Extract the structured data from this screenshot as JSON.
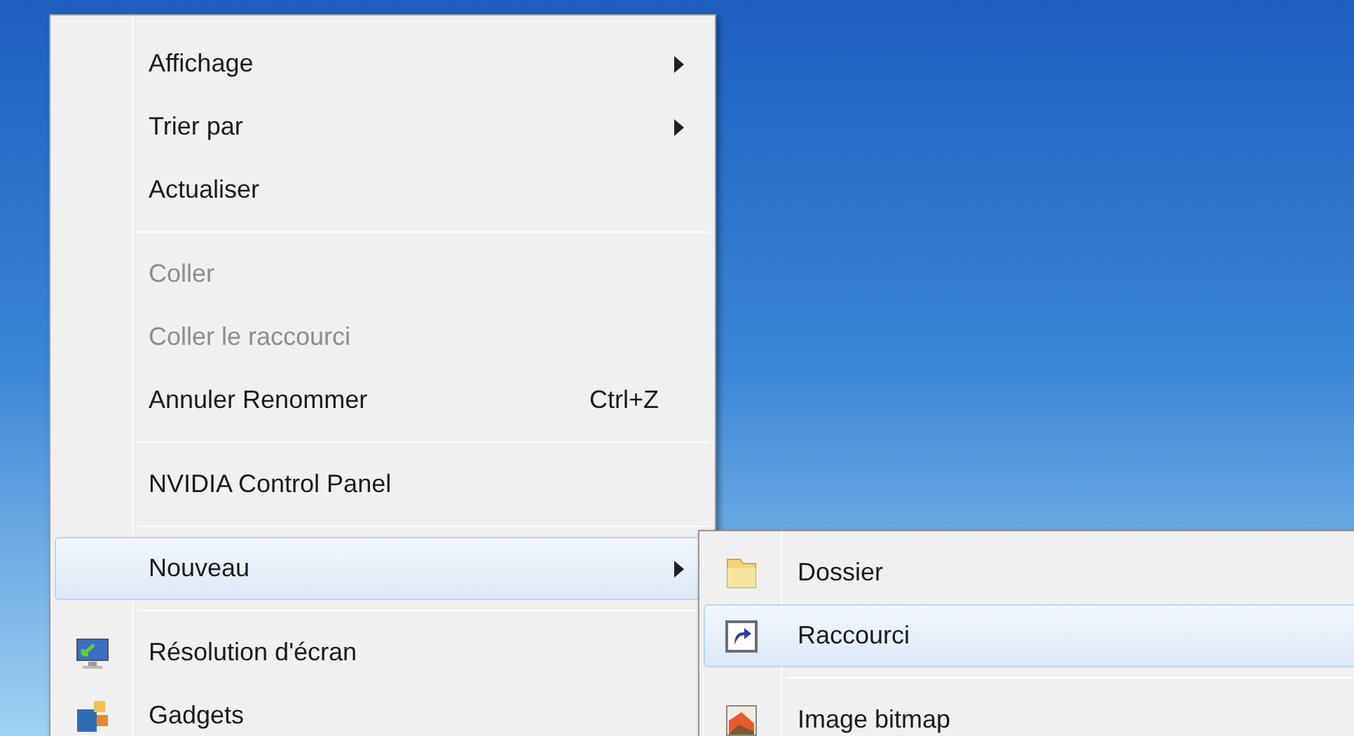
{
  "context_menu": {
    "items": [
      {
        "kind": "item",
        "label": "Affichage",
        "disabled": false,
        "submenu": true,
        "selected": false
      },
      {
        "kind": "item",
        "label": "Trier par",
        "disabled": false,
        "submenu": true,
        "selected": false
      },
      {
        "kind": "item",
        "label": "Actualiser",
        "disabled": false,
        "submenu": false,
        "selected": false
      },
      {
        "kind": "separator"
      },
      {
        "kind": "item",
        "label": "Coller",
        "disabled": true,
        "submenu": false,
        "selected": false
      },
      {
        "kind": "item",
        "label": "Coller le raccourci",
        "disabled": true,
        "submenu": false,
        "selected": false
      },
      {
        "kind": "item",
        "label": "Annuler Renommer",
        "shortcut": "Ctrl+Z",
        "disabled": false,
        "submenu": false,
        "selected": false
      },
      {
        "kind": "separator"
      },
      {
        "kind": "item",
        "label": "NVIDIA Control Panel",
        "disabled": false,
        "submenu": false,
        "selected": false
      },
      {
        "kind": "separator"
      },
      {
        "kind": "item",
        "label": "Nouveau",
        "disabled": false,
        "submenu": true,
        "selected": true
      },
      {
        "kind": "separator"
      },
      {
        "kind": "item",
        "label": "Résolution d'écran",
        "disabled": false,
        "submenu": false,
        "selected": false
      },
      {
        "kind": "item",
        "label": "Gadgets",
        "disabled": false,
        "submenu": false,
        "selected": false
      }
    ]
  },
  "submenu": {
    "items": [
      {
        "kind": "item",
        "label": "Dossier",
        "disabled": false,
        "submenu": false,
        "selected": false
      },
      {
        "kind": "item",
        "label": "Raccourci",
        "disabled": false,
        "submenu": false,
        "selected": true
      },
      {
        "kind": "separator"
      },
      {
        "kind": "item",
        "label": "Image bitmap",
        "disabled": false,
        "submenu": false,
        "selected": false
      }
    ]
  }
}
